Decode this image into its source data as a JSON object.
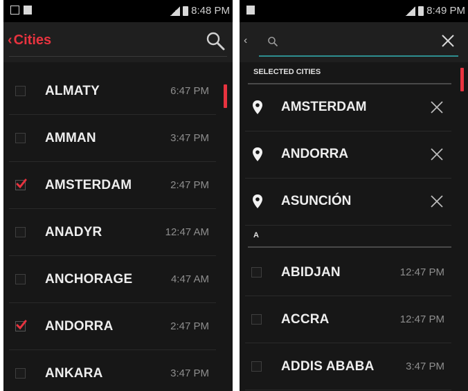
{
  "left_screen": {
    "status_time": "8:48 PM",
    "title": "Cities",
    "cities": [
      {
        "name": "ALMATY",
        "time": "6:47 PM",
        "checked": false
      },
      {
        "name": "AMMAN",
        "time": "3:47 PM",
        "checked": false
      },
      {
        "name": "AMSTERDAM",
        "time": "2:47 PM",
        "checked": true
      },
      {
        "name": "ANADYR",
        "time": "12:47 AM",
        "checked": false
      },
      {
        "name": "ANCHORAGE",
        "time": "4:47 AM",
        "checked": false
      },
      {
        "name": "ANDORRA",
        "time": "2:47 PM",
        "checked": true
      },
      {
        "name": "ANKARA",
        "time": "3:47 PM",
        "checked": false
      }
    ]
  },
  "right_screen": {
    "status_time": "8:49 PM",
    "search": {
      "placeholder": "",
      "value": ""
    },
    "selected_header": "SELECTED CITIES",
    "selected_cities": [
      {
        "name": "AMSTERDAM"
      },
      {
        "name": "ANDORRA"
      },
      {
        "name": "ASUNCIÓN"
      }
    ],
    "section_letter": "A",
    "cities": [
      {
        "name": "ABIDJAN",
        "time": "12:47 PM",
        "checked": false
      },
      {
        "name": "ACCRA",
        "time": "12:47 PM",
        "checked": false
      },
      {
        "name": "ADDIS ABABA",
        "time": "3:47 PM",
        "checked": false
      }
    ]
  },
  "colors": {
    "accent": "#e8333f",
    "search_underline": "#2e8f91",
    "background": "#171717"
  }
}
